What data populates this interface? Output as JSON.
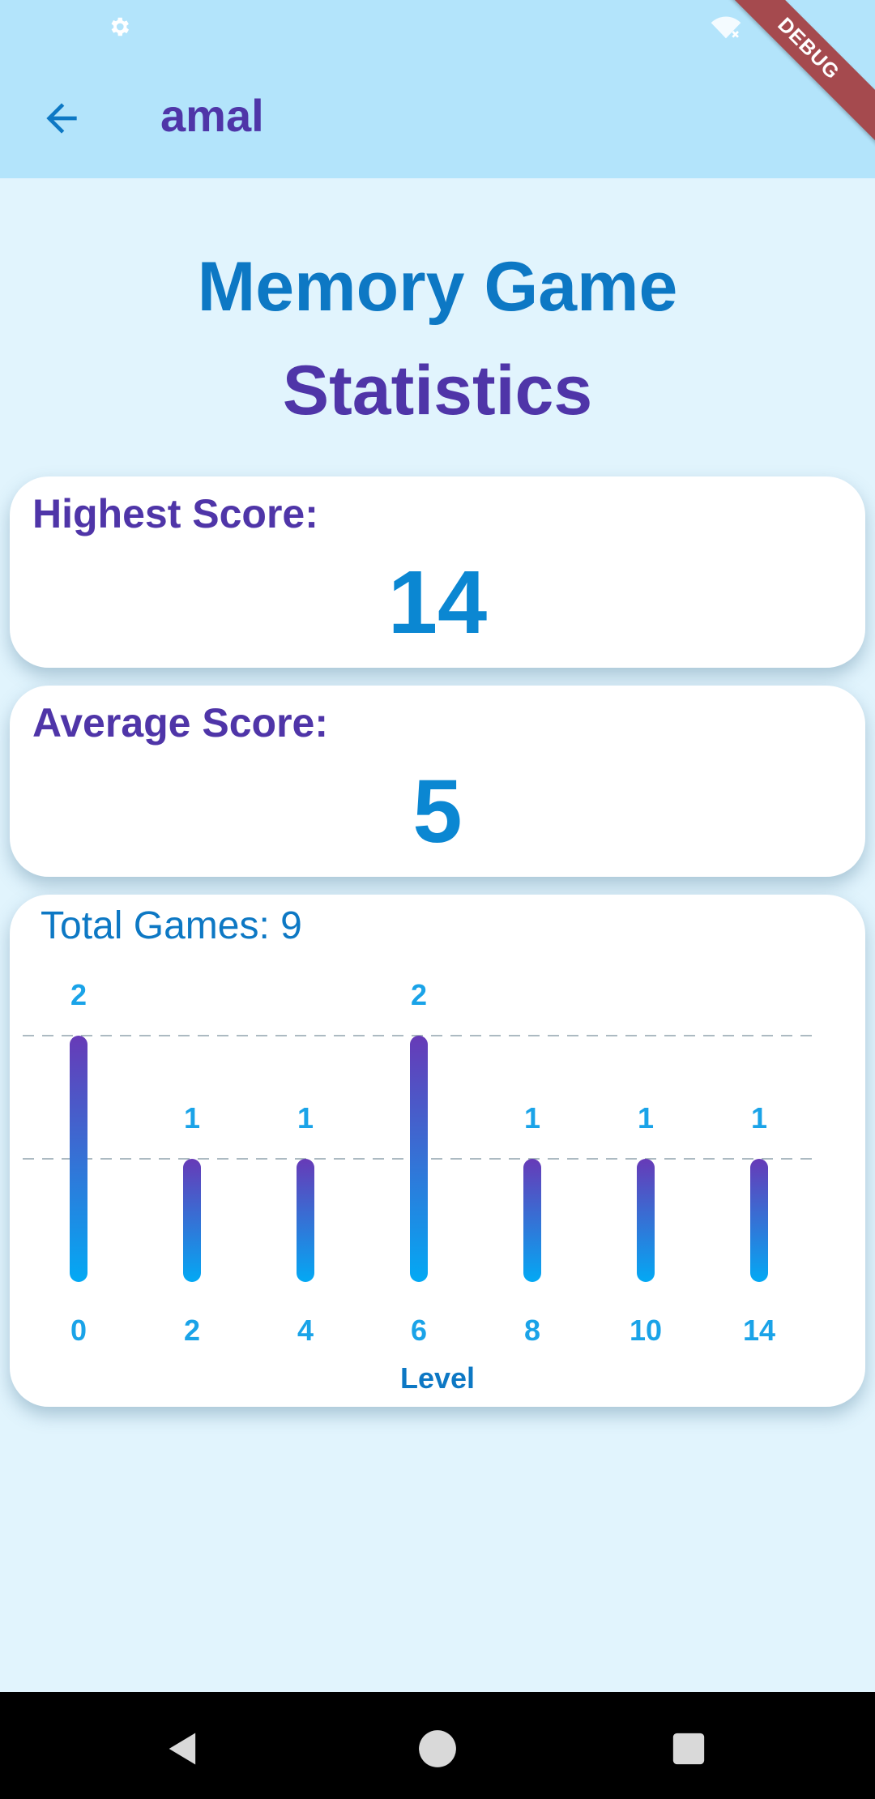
{
  "app_bar": {
    "title": "amal",
    "debug_banner": "DEBUG"
  },
  "heading": {
    "line1": "Memory Game",
    "line2": "Statistics"
  },
  "stats": {
    "highest_label": "Highest Score:",
    "highest_value": "14",
    "average_label": "Average Score:",
    "average_value": "5",
    "total_games_label": "Total Games:",
    "total_games_value": "9"
  },
  "chart_data": {
    "type": "bar",
    "categories": [
      "0",
      "2",
      "4",
      "6",
      "8",
      "10",
      "14"
    ],
    "values": [
      2,
      1,
      1,
      2,
      1,
      1,
      1
    ],
    "xlabel": "Level",
    "ylabel": "",
    "ylim": [
      0,
      2
    ],
    "grid": true,
    "gradient": {
      "top": "#673ab7",
      "bottom": "#03a9f4"
    }
  },
  "colors": {
    "label_purple": "#4f35a8",
    "value_blue": "#0b87d2",
    "tick_blue": "#1aa3e8"
  },
  "icons": {
    "status_left": "gear-icon",
    "status_right": "wifi-off-icon",
    "back": "arrow-back-icon",
    "nav_back": "triangle-back-icon",
    "nav_home": "circle-home-icon",
    "nav_recents": "square-recents-icon"
  }
}
